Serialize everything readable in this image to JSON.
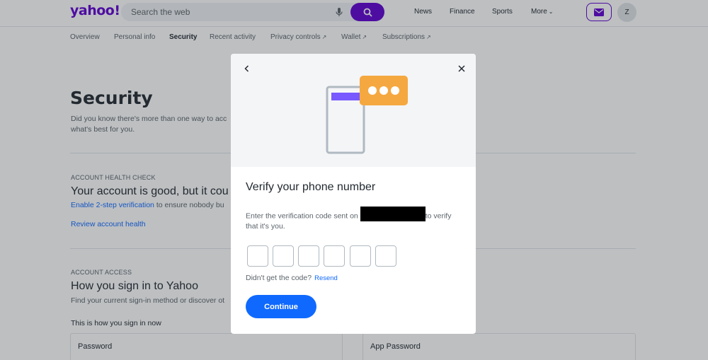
{
  "header": {
    "logo": "yahoo!",
    "search_placeholder": "Search the web",
    "nav": [
      "News",
      "Finance",
      "Sports",
      "More"
    ],
    "avatar_initial": "Z"
  },
  "subnav": {
    "items": [
      "Overview",
      "Personal info",
      "Security",
      "Recent activity",
      "Privacy controls",
      "Wallet",
      "Subscriptions"
    ],
    "active": "Security"
  },
  "page": {
    "title": "Security",
    "desc_line1": "Did you know there's more than one way to acc",
    "desc_line2": "what's best for you.",
    "health_label": "ACCOUNT HEALTH CHECK",
    "health_heading": "Your account is good, but it cou",
    "enable_link": "Enable 2-step verification",
    "enable_suffix": " to ensure nobody bu",
    "review_link": "Review account health",
    "access_label": "ACCOUNT ACCESS",
    "access_heading": "How you sign in to Yahoo",
    "access_desc": "Find your current sign-in method or discover ot",
    "signin_now": "This is how you sign in now",
    "card_password": "Password",
    "card_app_password": "App Password"
  },
  "modal": {
    "title": "Verify your phone number",
    "text_before": "Enter the verification code sent on ",
    "text_after": "to verify",
    "text_line2": "that it's you.",
    "didnt_get": "Didn't get the code?",
    "resend": "Resend",
    "continue_label": "Continue",
    "code_length": 6
  },
  "colors": {
    "brand": "#6001d2",
    "link": "#0f69ff",
    "accent_orange": "#f5a840"
  }
}
